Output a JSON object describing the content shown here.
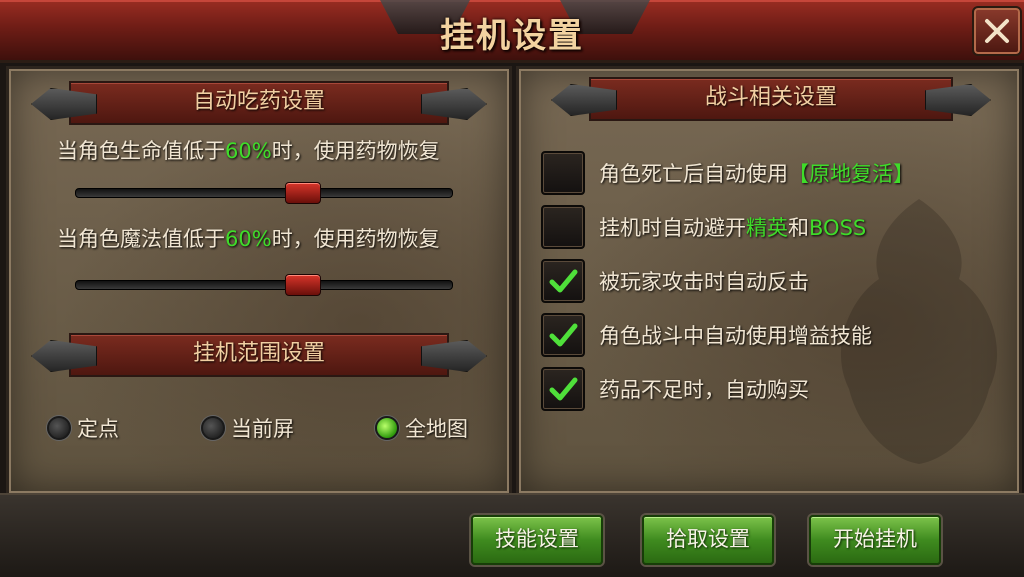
{
  "window": {
    "title": "挂机设置"
  },
  "left": {
    "potion_section": {
      "title": "自动吃药设置",
      "hp": {
        "prefix": "当角色生命值低于",
        "percent": "60%",
        "suffix": "时，使用药物恢复",
        "value": 0.6
      },
      "mp": {
        "prefix": "当角色魔法值低于",
        "percent": "60%",
        "suffix": "时，使用药物恢复",
        "value": 0.6
      }
    },
    "range_section": {
      "title": "挂机范围设置",
      "options": [
        {
          "label": "定点",
          "selected": false
        },
        {
          "label": "当前屏",
          "selected": false
        },
        {
          "label": "全地图",
          "selected": true
        }
      ]
    }
  },
  "right": {
    "combat_section": {
      "title": "战斗相关设置",
      "options": [
        {
          "parts": [
            "角色死亡后自动使用",
            "【原地复活】"
          ],
          "checked": false
        },
        {
          "parts": [
            "挂机时自动避开",
            "精英",
            "和",
            "BOSS"
          ],
          "checked": false
        },
        {
          "parts": [
            "被玩家攻击时自动反击"
          ],
          "checked": true
        },
        {
          "parts": [
            "角色战斗中自动使用增益技能"
          ],
          "checked": true
        },
        {
          "parts": [
            "药品不足时，自动购买"
          ],
          "checked": true
        }
      ]
    }
  },
  "footer": {
    "skill_button": "技能设置",
    "pickup_button": "拾取设置",
    "start_button": "开始挂机"
  },
  "colors": {
    "accent_green": "#3fdc2a",
    "title_red": "#7a2b1f"
  },
  "icons": {
    "close": "close-icon",
    "check": "checkmark-icon"
  }
}
